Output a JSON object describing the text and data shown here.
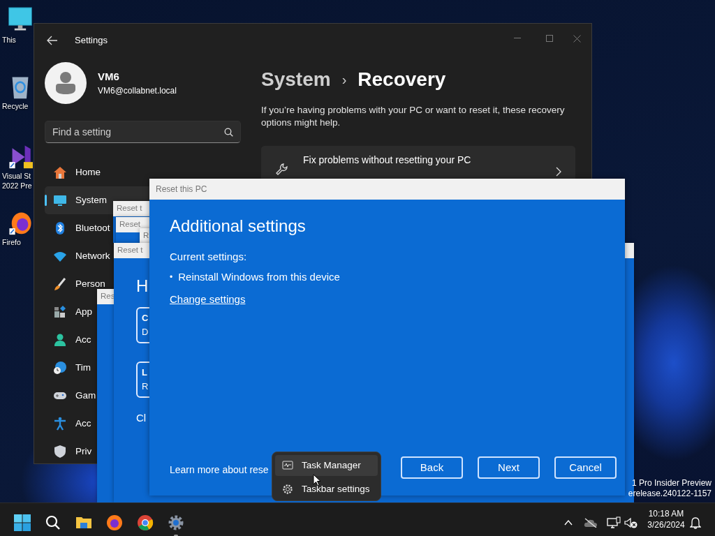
{
  "desktop_icons": [
    {
      "lines": [
        "This"
      ]
    },
    {
      "lines": [
        "Recycle"
      ]
    },
    {
      "lines": [
        "Visual St",
        "2022 Pre"
      ]
    },
    {
      "lines": [
        "Firefo"
      ]
    }
  ],
  "settings_window": {
    "title": "Settings",
    "user": {
      "name": "VM6",
      "email": "VM6@collabnet.local"
    },
    "search": {
      "placeholder": "Find a setting"
    },
    "nav": [
      {
        "label": "Home",
        "selected": false
      },
      {
        "label": "System",
        "selected": true
      },
      {
        "label": "Bluetoot",
        "selected": false
      },
      {
        "label": "Network",
        "selected": false
      },
      {
        "label": "Person",
        "selected": false
      },
      {
        "label": "App",
        "selected": false
      },
      {
        "label": "Acc",
        "selected": false
      },
      {
        "label": "Tim",
        "selected": false
      },
      {
        "label": "Gam",
        "selected": false
      },
      {
        "label": "Acc",
        "selected": false
      },
      {
        "label": "Priv",
        "selected": false
      }
    ],
    "breadcrumb": {
      "parent": "System",
      "separator": "›",
      "current": "Recovery"
    },
    "description": "If you’re having problems with your PC or want to reset it, these recovery options might help.",
    "card": {
      "title": "Fix problems without resetting your PC"
    }
  },
  "background_dialogs": [
    {
      "title": "Res"
    },
    {
      "title": "Reset t"
    },
    {
      "title": "Reset"
    },
    {
      "title": "R"
    },
    {
      "title": "Reset t",
      "heading": "H",
      "options": [
        {
          "title": "C",
          "subtitle": "D"
        },
        {
          "title": "L",
          "subtitle": "R"
        }
      ],
      "footer": "Cl"
    }
  ],
  "dialog": {
    "title": "Reset this PC",
    "heading": "Additional settings",
    "current_label": "Current settings:",
    "current_items": [
      {
        "marker": "•",
        "text": "Reinstall Windows from this device"
      }
    ],
    "link": "Change settings",
    "learn_more": "Learn more about rese",
    "buttons": [
      "Back",
      "Next",
      "Cancel"
    ]
  },
  "context_menu": [
    {
      "label": "Task Manager",
      "selected": true
    },
    {
      "label": "Taskbar settings",
      "selected": false
    }
  ],
  "build_info": [
    "1 Pro Insider Preview",
    "erelease.240122-1157"
  ],
  "taskbar": {
    "apps": [
      {
        "running": false
      },
      {
        "running": false
      },
      {
        "running": false
      },
      {
        "running": true
      }
    ],
    "time": "10:18 AM",
    "date": "3/26/2024"
  }
}
